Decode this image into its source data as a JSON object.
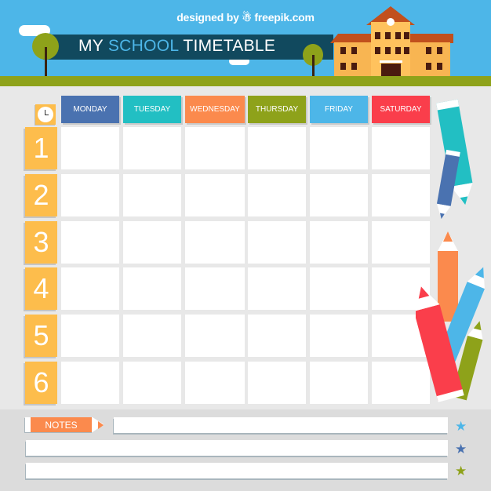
{
  "header": {
    "credit": "designed by ☃ freepik.com",
    "title_part1": "MY ",
    "title_accent": "SCHOOL",
    "title_part2": " TIMETABLE"
  },
  "timetable": {
    "clock_icon": "clock-icon",
    "days": [
      {
        "label": "MONDAY",
        "color": "#4a72b0"
      },
      {
        "label": "TUESDAY",
        "color": "#22bfc3"
      },
      {
        "label": "WEDNESDAY",
        "color": "#fb8a4d"
      },
      {
        "label": "THURSDAY",
        "color": "#8ea21a"
      },
      {
        "label": "FRIDAY",
        "color": "#4db6e8"
      },
      {
        "label": "SATURDAY",
        "color": "#fa3e4b"
      }
    ],
    "periods": [
      "1",
      "2",
      "3",
      "4",
      "5",
      "6"
    ],
    "period_color": "#fdbd4c"
  },
  "notes": {
    "label": "NOTES",
    "label_color": "#fb8a4d",
    "stars": [
      {
        "icon": "star-icon",
        "color": "#4db6e8"
      },
      {
        "icon": "star-icon",
        "color": "#4a72b0"
      },
      {
        "icon": "star-icon",
        "color": "#8ea21a"
      }
    ]
  },
  "decor": {
    "pencils": [
      "teal",
      "blue",
      "orange",
      "light-blue",
      "red",
      "green"
    ]
  }
}
